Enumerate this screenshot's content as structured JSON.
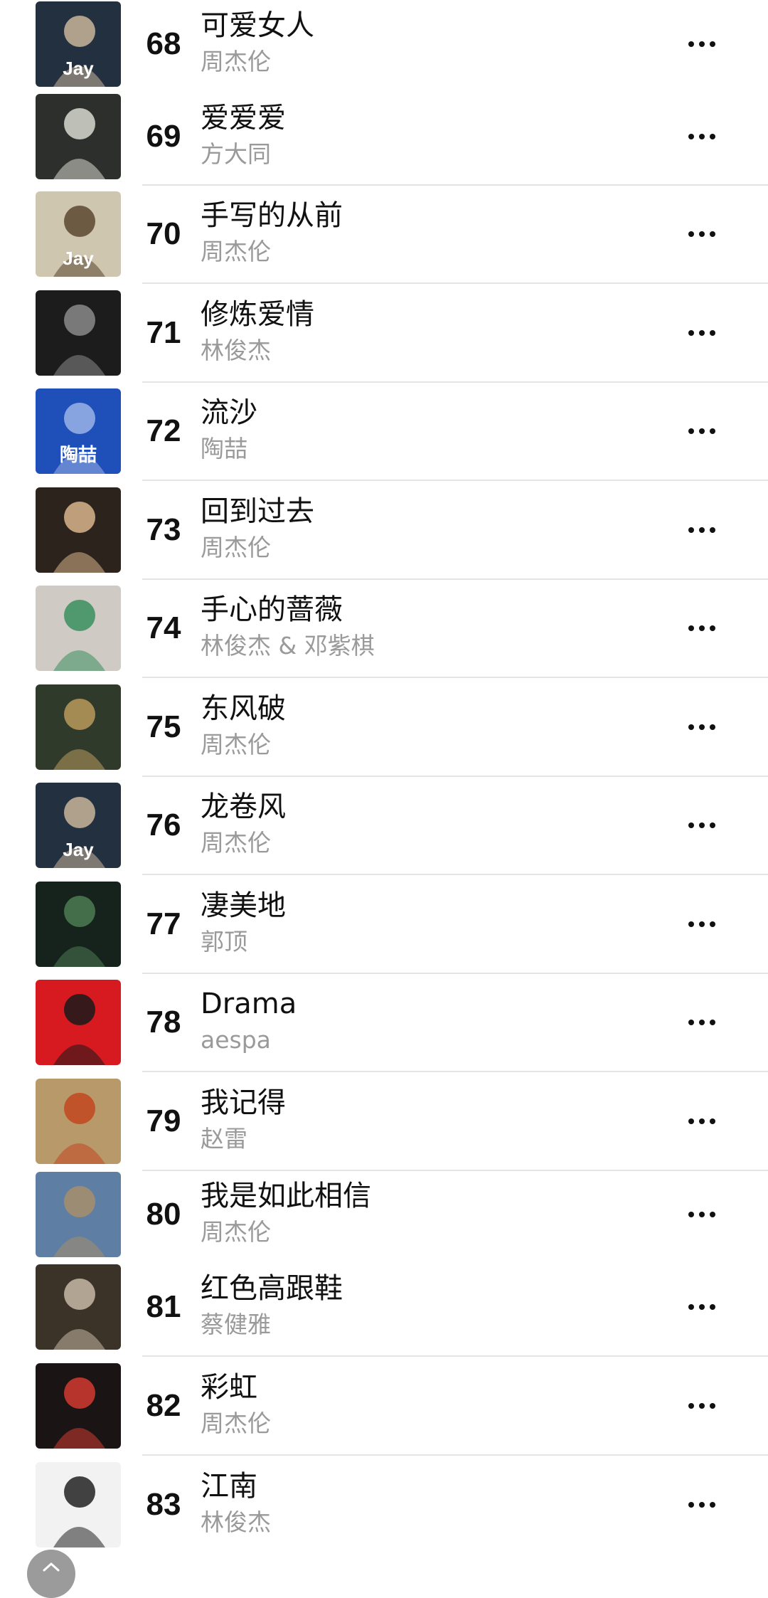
{
  "songs": [
    {
      "rank": "68",
      "title": "可爱女人",
      "artist": "周杰伦",
      "art": {
        "bg": "#23303f",
        "accent": "#c9b59a",
        "label": "Jay"
      }
    },
    {
      "rank": "69",
      "title": "爱爱爱",
      "artist": "方大同",
      "art": {
        "bg": "#2c2f2b",
        "accent": "#d8d8d0",
        "label": ""
      }
    },
    {
      "rank": "70",
      "title": "手写的从前",
      "artist": "周杰伦",
      "art": {
        "bg": "#cfc6b0",
        "accent": "#5a4630",
        "label": "Jay"
      }
    },
    {
      "rank": "71",
      "title": "修炼爱情",
      "artist": "林俊杰",
      "art": {
        "bg": "#1c1c1c",
        "accent": "#8a8a8a",
        "label": ""
      }
    },
    {
      "rank": "72",
      "title": "流沙",
      "artist": "陶喆",
      "art": {
        "bg": "#1f4fb8",
        "accent": "#9ab3e8",
        "label": "陶喆"
      }
    },
    {
      "rank": "73",
      "title": "回到过去",
      "artist": "周杰伦",
      "art": {
        "bg": "#2b231c",
        "accent": "#d9b48c",
        "label": ""
      }
    },
    {
      "rank": "74",
      "title": "手心的蔷薇",
      "artist": "林俊杰 & 邓紫棋",
      "art": {
        "bg": "#cfcac4",
        "accent": "#3a8f5e",
        "label": ""
      }
    },
    {
      "rank": "75",
      "title": "东风破",
      "artist": "周杰伦",
      "art": {
        "bg": "#2f3a2a",
        "accent": "#b89a5c",
        "label": ""
      }
    },
    {
      "rank": "76",
      "title": "龙卷风",
      "artist": "周杰伦",
      "art": {
        "bg": "#23303f",
        "accent": "#c9b59a",
        "label": "Jay"
      }
    },
    {
      "rank": "77",
      "title": "凄美地",
      "artist": "郭顶",
      "art": {
        "bg": "#16231c",
        "accent": "#4c7a52",
        "label": ""
      }
    },
    {
      "rank": "78",
      "title": "Drama",
      "artist": "aespa",
      "art": {
        "bg": "#d71920",
        "accent": "#1a1a1a",
        "label": ""
      }
    },
    {
      "rank": "79",
      "title": "我记得",
      "artist": "赵雷",
      "art": {
        "bg": "#b89a6a",
        "accent": "#c2461f",
        "label": ""
      }
    },
    {
      "rank": "80",
      "title": "我是如此相信",
      "artist": "周杰伦",
      "art": {
        "bg": "#5e7fa3",
        "accent": "#a88e6c",
        "label": ""
      }
    },
    {
      "rank": "81",
      "title": "红色高跟鞋",
      "artist": "蔡健雅",
      "art": {
        "bg": "#3b3228",
        "accent": "#c7b9a4",
        "label": ""
      }
    },
    {
      "rank": "82",
      "title": "彩虹",
      "artist": "周杰伦",
      "art": {
        "bg": "#1a1414",
        "accent": "#d23a2f",
        "label": ""
      }
    },
    {
      "rank": "83",
      "title": "江南",
      "artist": "林俊杰",
      "art": {
        "bg": "#f2f2f2",
        "accent": "#222222",
        "label": ""
      }
    }
  ],
  "colors": {
    "title": "#111111",
    "artist": "#9a9a9a",
    "separator": "#e4e4e4"
  },
  "icons": {
    "more": "ellipsis-horizontal-icon",
    "scroll": "chevron-up-icon"
  }
}
